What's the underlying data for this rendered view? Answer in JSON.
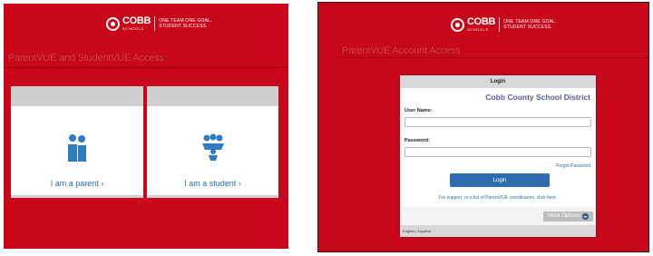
{
  "left": {
    "logo": {
      "word": "COBB",
      "sub": "SCHOOLS",
      "slogan_line1": "ONE TEAM.ONE GOAL.",
      "slogan_line2": "STUDENT SUCCESS."
    },
    "title": "ParentVUE and StudentVUE Access",
    "parent_card": {
      "label": "I am a parent",
      "chevron": "›"
    },
    "student_card": {
      "label": "I am a student",
      "chevron": "›"
    }
  },
  "right": {
    "logo": {
      "word": "COBB",
      "sub": "SCHOOLS",
      "slogan_line1": "ONE TEAM.ONE GOAL.",
      "slogan_line2": "STUDENT SUCCESS."
    },
    "title": "ParentVUE Account Access",
    "login": {
      "header": "Login",
      "district": "Cobb County School District",
      "username_label": "User Name:",
      "username_value": "",
      "password_label": "Password:",
      "password_value": "",
      "forgot": "Forgot Password",
      "button": "Login",
      "support": "For support, or a list of ParentVUE coordinators, click here.",
      "more_options": "More Options",
      "footer_english": "English",
      "footer_sep": "|",
      "footer_espanol": "Español"
    }
  },
  "colors": {
    "brand_red": "#c8081a",
    "link_blue": "#2a6fb3",
    "button_blue": "#2f6db1",
    "district_purple": "#5a5a96"
  },
  "icons": [
    "parent-figures-icon",
    "student-group-icon",
    "chevron-down-icon"
  ]
}
